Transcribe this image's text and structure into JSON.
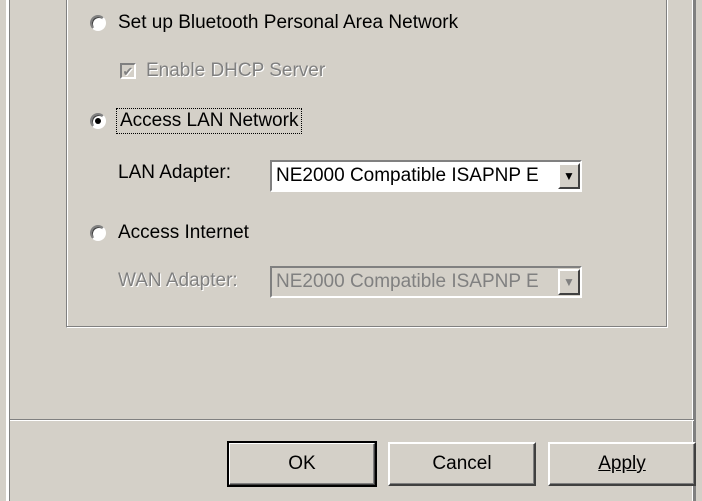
{
  "options": {
    "pan_label": "Set up Bluetooth Personal Area Network",
    "dhcp_label": "Enable DHCP Server",
    "lan_label": "Access LAN Network",
    "lan_adapter_label": "LAN Adapter:",
    "lan_adapter_value": "NE2000 Compatible ISAPNP E",
    "internet_label": "Access Internet",
    "wan_adapter_label": "WAN Adapter:",
    "wan_adapter_value": "NE2000 Compatible ISAPNP E"
  },
  "buttons": {
    "ok": "OK",
    "cancel": "Cancel",
    "apply": "Apply"
  },
  "icons": {
    "checkmark": "✔",
    "dropdown_arrow": "▼"
  }
}
